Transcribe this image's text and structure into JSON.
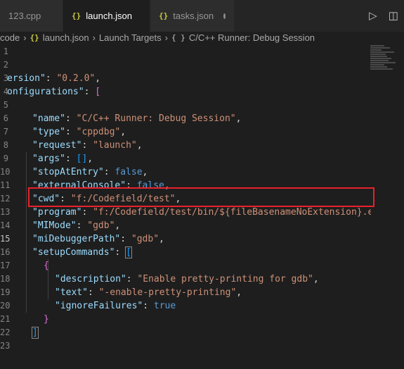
{
  "tabs": [
    {
      "label": "123.cpp",
      "icon": "cpp-file-icon",
      "active": false
    },
    {
      "label": "launch.json",
      "icon": "json-braces-icon",
      "active": true,
      "dirty": true
    },
    {
      "label": "tasks.json",
      "icon": "json-braces-icon",
      "active": false,
      "dirty": true
    }
  ],
  "breadcrumb": {
    "folder": "code",
    "file": "launch.json",
    "section": "Launch Targets",
    "object": "C/C++ Runner: Debug Session",
    "json_icon_glyph": "{}",
    "object_icon_glyph": "{ }"
  },
  "editor": {
    "current_line": 15,
    "line_numbers": [
      "1",
      "2",
      "3",
      "4",
      "5",
      "6",
      "7",
      "8",
      "9",
      "10",
      "11",
      "12",
      "13",
      "14",
      "15",
      "16",
      "17",
      "18",
      "19",
      "20",
      "21",
      "22",
      "23"
    ],
    "code": {
      "l2": {
        "key": "ersion\"",
        "val": "\"0.2.0\""
      },
      "l3": {
        "key": "onfigurations\""
      },
      "l5": {
        "key": "\"name\"",
        "val": "\"C/C++ Runner: Debug Session\""
      },
      "l6": {
        "key": "\"type\"",
        "val": "\"cppdbg\""
      },
      "l7": {
        "key": "\"request\"",
        "val": "\"launch\""
      },
      "l8": {
        "key": "\"args\"",
        "val": "[]"
      },
      "l9": {
        "key": "\"stopAtEntry\"",
        "val": "false"
      },
      "l10": {
        "key": "\"externalConsole\"",
        "val": "false"
      },
      "l11": {
        "key": "\"cwd\"",
        "val": "\"f:/Codefield/test\""
      },
      "l12": {
        "key": "\"program\"",
        "val": "\"f:/Codefield/test/bin/${fileBasenameNoExtension}.e"
      },
      "l13": {
        "key": "\"MIMode\"",
        "val": "\"gdb\""
      },
      "l14": {
        "key": "\"miDebuggerPath\"",
        "val": "\"gdb\""
      },
      "l15": {
        "key": "\"setupCommands\""
      },
      "l17": {
        "key": "\"description\"",
        "val": "\"Enable pretty-printing for gdb\""
      },
      "l18": {
        "key": "\"text\"",
        "val": "\"-enable-pretty-printing\""
      },
      "l19": {
        "key": "\"ignoreFailures\"",
        "val": "true"
      }
    }
  },
  "actions": {
    "run_icon": "run-icon",
    "split_icon": "split-editor-icon"
  },
  "colors": {
    "highlight_box": "#e8212c",
    "json_icon": "#cbcb41"
  }
}
